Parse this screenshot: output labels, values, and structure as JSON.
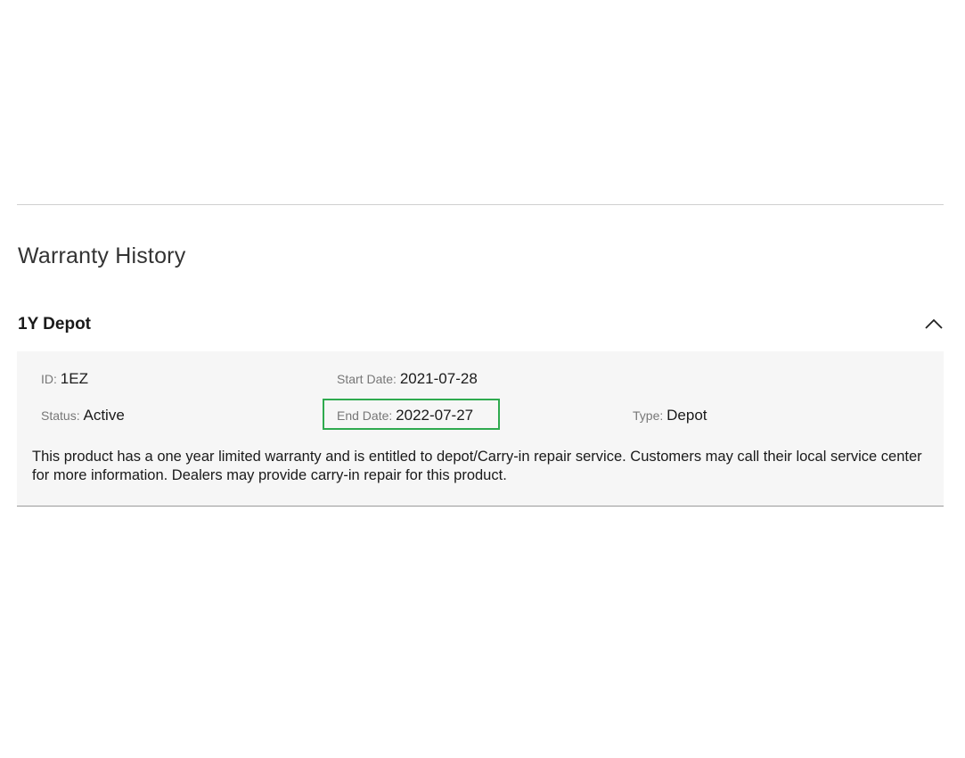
{
  "section": {
    "title": "Warranty History"
  },
  "warranty": {
    "name": "1Y Depot",
    "expanded": true,
    "id_label": "ID",
    "id_value": "1EZ",
    "start_label": "Start Date",
    "start_value": "2021-07-28",
    "status_label": "Status",
    "status_value": "Active",
    "end_label": "End Date",
    "end_value": "2022-07-27",
    "type_label": "Type",
    "type_value": "Depot",
    "description": "This product has a one year limited warranty and is entitled to depot/Carry-in repair service. Customers may call their local service center for more information. Dealers may provide carry-in repair for this product."
  },
  "icons": {
    "collapse": "chevron-up-icon"
  },
  "colors": {
    "highlight": "#2faa4f",
    "panel_background": "#f6f6f6",
    "label_gray": "#777777"
  }
}
